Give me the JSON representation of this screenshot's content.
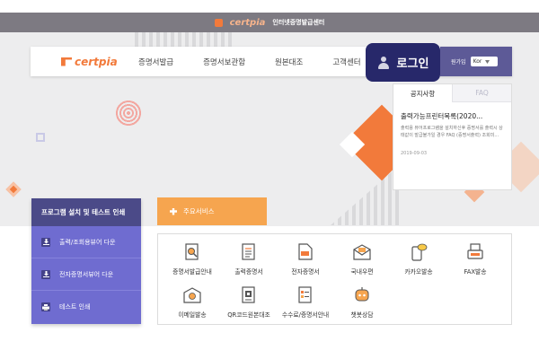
{
  "topbar": {
    "logo": "certpia",
    "title": "인터넷증명발급센터"
  },
  "navbar": {
    "logo": "certpia",
    "items": [
      "증명서발급",
      "증명서보관함",
      "원본대조",
      "고객센터"
    ],
    "lang_label": "원가입",
    "lang_value": "Kor"
  },
  "login": {
    "label": "로그인"
  },
  "notice": {
    "tabs": [
      "공지사항",
      "FAQ"
    ],
    "title": "출력가능프린터목록(2020...",
    "text": "출력용 뷰어프로그램을 설치하신후 증명서를 출력시 상태값이 발급불가일 경우 FAQ (증명서출력) 조회미...",
    "date": "2019-09-03"
  },
  "program": {
    "header": "프로그램 설치 및 테스트 인쇄",
    "items": [
      {
        "label": "출력/조회용뷰어 다운",
        "icon": "download-icon"
      },
      {
        "label": "전자증명서뷰어 다운",
        "icon": "download-icon"
      },
      {
        "label": "테스트 인쇄",
        "icon": "printer-icon"
      }
    ]
  },
  "services": {
    "tab_label": "주요서비스",
    "items": [
      {
        "label": "증명서발급안내",
        "icon": "document-search-icon"
      },
      {
        "label": "출력증명서",
        "icon": "document-icon"
      },
      {
        "label": "전자증명서",
        "icon": "pdf-document-icon"
      },
      {
        "label": "국내우편",
        "icon": "mail-icon"
      },
      {
        "label": "카카오발송",
        "icon": "kakao-phone-icon"
      },
      {
        "label": "FAX발송",
        "icon": "fax-icon"
      },
      {
        "label": "이메일발송",
        "icon": "email-at-icon"
      },
      {
        "label": "QR코드원본대조",
        "icon": "qr-document-icon"
      },
      {
        "label": "수수료/증명서안내",
        "icon": "checklist-icon"
      },
      {
        "label": "챗봇상담",
        "icon": "chatbot-icon"
      }
    ]
  },
  "colors": {
    "accent_orange": "#f27a3b",
    "service_orange": "#f6a54f",
    "purple": "#6f6cd0",
    "purple_dark": "#4b4a88",
    "login_navy": "#27286a"
  }
}
